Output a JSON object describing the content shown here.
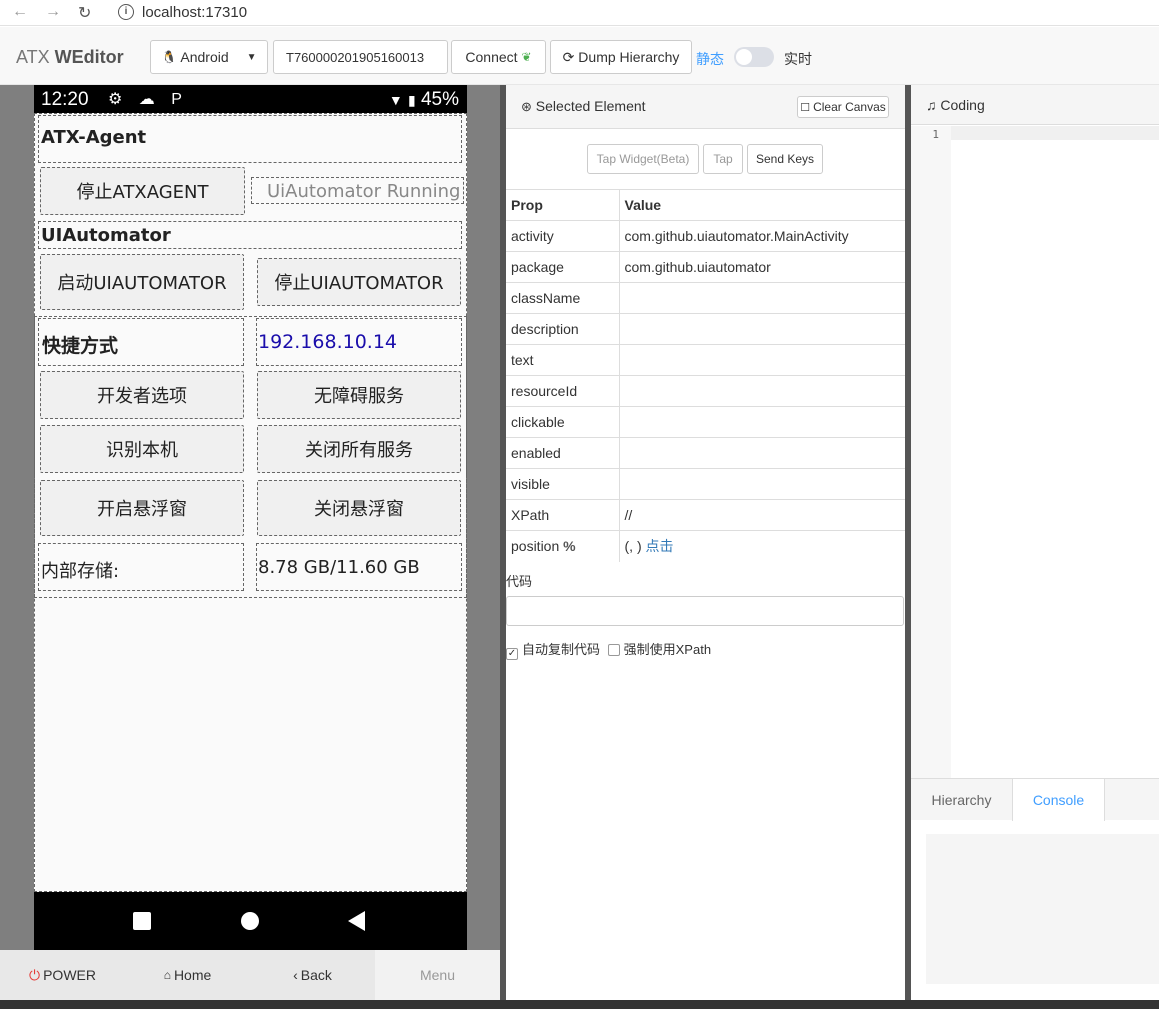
{
  "browser": {
    "url": "localhost:17310"
  },
  "header": {
    "brand_light": "ATX ",
    "brand_bold": "WEditor",
    "platform": "Android",
    "device_serial": "T760000201905160013",
    "connect_label": "Connect",
    "dump_label": "Dump Hierarchy",
    "mode_static": "静态",
    "mode_realtime": "实时"
  },
  "phone": {
    "status": {
      "time": "12:20",
      "icons": "⚙ ☁ P",
      "battery": "45%"
    },
    "app": {
      "section_agent": "ATX-Agent",
      "stop_agent": "停止ATXAGENT",
      "uiautomator_status": "UiAutomator Running",
      "section_uiautomator": "UIAutomator",
      "start_uiautomator": "启动UIAUTOMATOR",
      "stop_uiautomator": "停止UIAUTOMATOR",
      "shortcut_label": "快捷方式",
      "ip_address": "192.168.10.14",
      "dev_options": "开发者选项",
      "accessibility": "无障碍服务",
      "identify_device": "识别本机",
      "close_services": "关闭所有服务",
      "open_float": "开启悬浮窗",
      "close_float": "关闭悬浮窗",
      "storage_label": "内部存储:",
      "storage_value": "8.78 GB/11.60 GB"
    }
  },
  "controls": {
    "power": "POWER",
    "home": "Home",
    "back": "Back",
    "menu": "Menu"
  },
  "inspector": {
    "title": "Selected Element",
    "clear_canvas": "Clear Canvas",
    "tap_widget": "Tap Widget(Beta)",
    "tap": "Tap",
    "send_keys": "Send Keys",
    "col_prop": "Prop",
    "col_value": "Value",
    "rows": [
      {
        "prop": "activity",
        "value": "com.github.uiautomator.MainActivity"
      },
      {
        "prop": "package",
        "value": "com.github.uiautomator"
      },
      {
        "prop": "className",
        "value": ""
      },
      {
        "prop": "description",
        "value": ""
      },
      {
        "prop": "text",
        "value": ""
      },
      {
        "prop": "resourceId",
        "value": ""
      },
      {
        "prop": "clickable",
        "value": ""
      },
      {
        "prop": "enabled",
        "value": ""
      },
      {
        "prop": "visible",
        "value": ""
      },
      {
        "prop": "XPath",
        "value": "//"
      }
    ],
    "position_label": "position",
    "position_value": "(, )",
    "position_link": "点击",
    "code_label": "代码",
    "auto_copy": "自动复制代码",
    "force_xpath": "强制使用XPath"
  },
  "coding": {
    "title": "Coding",
    "line_number": "1",
    "tab_hierarchy": "Hierarchy",
    "tab_console": "Console"
  },
  "colors": {
    "accent": "#409eff",
    "link_blue": "#1a0dab"
  }
}
